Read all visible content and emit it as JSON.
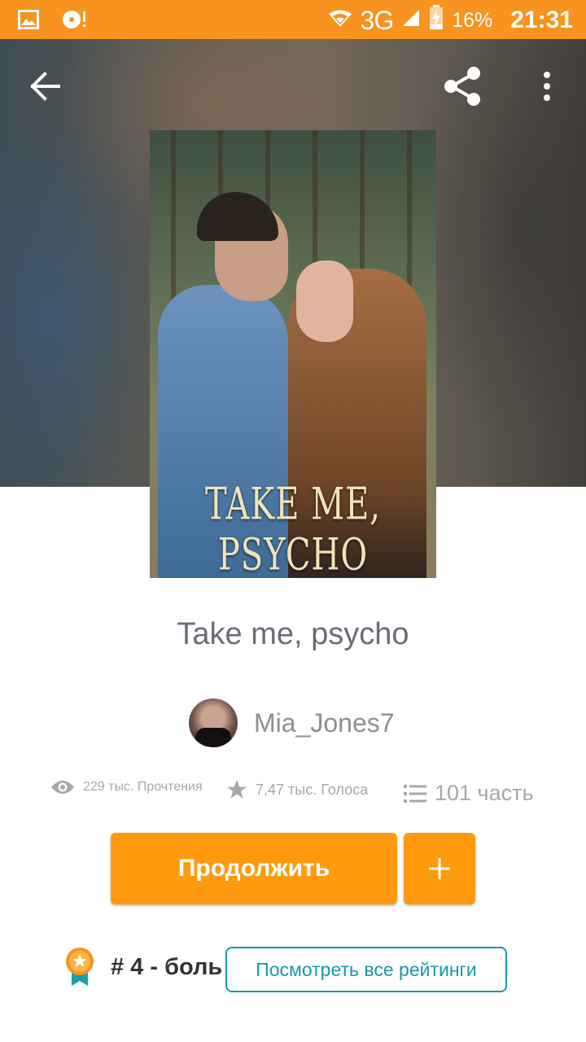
{
  "status_bar": {
    "network": "3G",
    "battery": "16%",
    "time": "21:31"
  },
  "story": {
    "cover_title": "TAKE ME, PSYCHO",
    "title": "Take me, psycho",
    "author": "Mia_Jones7",
    "reads": "229 тыс. Прочтения",
    "votes": "7,47 тыс. Голоса",
    "parts": "101 часть"
  },
  "actions": {
    "continue_label": "Продолжить",
    "add_label": "+"
  },
  "ranking": {
    "text": "# 4 - боль",
    "view_all_label": "Посмотреть все рейтинги"
  },
  "colors": {
    "accent": "#ff9a0e",
    "status_bar": "#f7931e",
    "teal": "#1a97a8"
  }
}
